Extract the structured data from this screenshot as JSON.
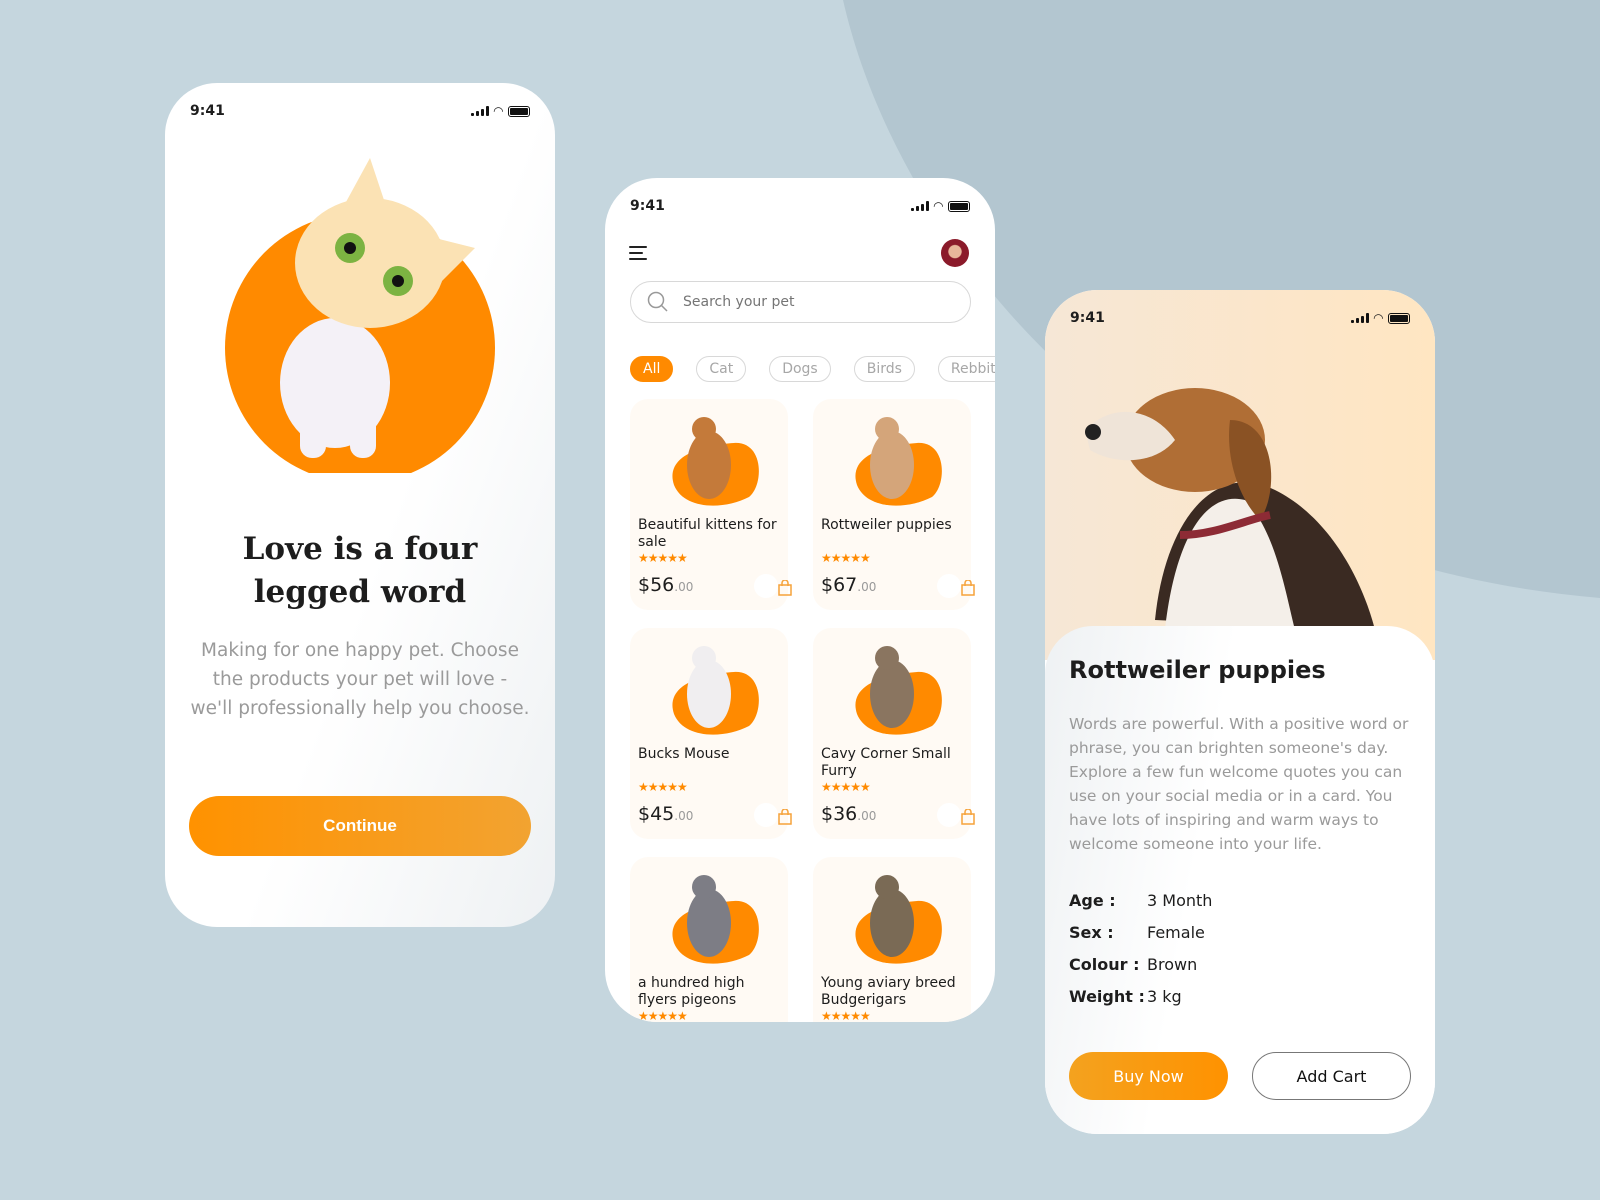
{
  "colors": {
    "accent": "#ff8a00",
    "background": "#c5d6de"
  },
  "status_time": "9:41",
  "onboarding": {
    "title": "Love is a four legged word",
    "description": "Making for one happy pet. Choose the products your pet will love - we'll professionally help you choose.",
    "continue_label": "Continue"
  },
  "listing": {
    "search_placeholder": "Search your pet",
    "categories": [
      "All",
      "Cat",
      "Dogs",
      "Birds",
      "Rebbit"
    ],
    "selected_category": "All",
    "products": [
      {
        "name": "Beautiful kittens for sale",
        "rating": 5,
        "price": "$56",
        "cents": ".00"
      },
      {
        "name": "Rottweiler puppies",
        "rating": 5,
        "price": "$67",
        "cents": ".00"
      },
      {
        "name": "Bucks Mouse",
        "rating": 5,
        "price": "$45",
        "cents": ".00"
      },
      {
        "name": "Cavy Corner Small Furry",
        "rating": 5,
        "price": "$36",
        "cents": ".00"
      },
      {
        "name": "a hundred high flyers pigeons",
        "rating": 5
      },
      {
        "name": "Young aviary breed Budgerigars",
        "rating": 5
      }
    ]
  },
  "detail": {
    "title": "Rottweiler puppies",
    "description": "Words are powerful. With a positive word or phrase, you can brighten someone's day. Explore a few fun welcome quotes you can use on your social media or in a card. You have lots of inspiring and warm ways to welcome someone into your life.",
    "specs": [
      {
        "label": "Age :",
        "value": "3 Month"
      },
      {
        "label": "Sex :",
        "value": "Female"
      },
      {
        "label": "Colour :",
        "value": "Brown"
      },
      {
        "label": "Weight :",
        "value": "3 kg"
      }
    ],
    "buy_label": "Buy Now",
    "add_label": "Add Cart"
  }
}
